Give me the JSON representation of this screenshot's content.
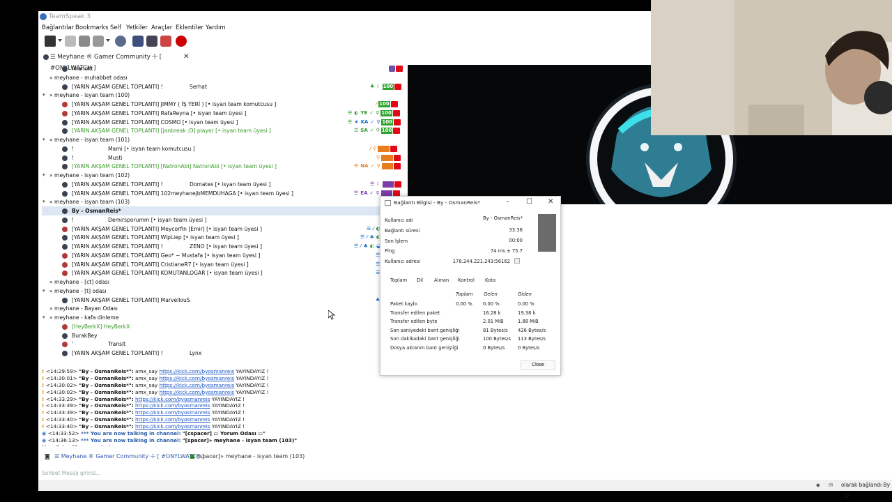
{
  "window": {
    "title": "TeamSpeak 3"
  },
  "menu": [
    "Bağlantılar",
    "Bookmarks",
    "Self",
    "Yetkiler",
    "Araçlar",
    "Eklentiler",
    "Yardım"
  ],
  "server_tab": {
    "label": "☰ Meyhane ® Gamer Community ☩ [ #ONYLWATCH ]"
  },
  "tree": [
    {
      "level": 3,
      "kind": "user",
      "text": "ilhanokt",
      "badges": [
        "sq-purple",
        "tr"
      ]
    },
    {
      "level": 1,
      "kind": "channel",
      "text": "» meyhane - muhabbet odası"
    },
    {
      "level": 3,
      "kind": "user",
      "text": "[YARIN AKŞAM GENEL TOPLANTI] !",
      "text2": "Serhat",
      "badges": [
        "g:♣",
        "g:☾",
        "num:100",
        "tr"
      ]
    },
    {
      "level": 1,
      "kind": "channel-open",
      "text": "» meyhane - isyan team (100)"
    },
    {
      "level": 3,
      "kind": "user-red",
      "text": "[YARIN AKŞAM GENEL TOPLANTI] JIMMY ( İŞ YERİ ) [• isyan team komutcusu ]",
      "badges": [
        "o:⁄",
        "num:100",
        "tr"
      ]
    },
    {
      "level": 3,
      "kind": "user-red",
      "text": "[YARIN AKŞAM GENEL TOPLANTI] RafaReyna [• isyan team üyesi ]",
      "badges": [
        "g:☰",
        "g:◐",
        "g:YE",
        "g:✓",
        "g:⚲",
        "num:100",
        "tr"
      ]
    },
    {
      "level": 3,
      "kind": "user",
      "text": "[YARIN AKŞAM GENEL TOPLANTI] COSMO [• isyan team üyesi ]",
      "badges": [
        "g:☰",
        "b:★",
        "b:KA",
        "b:✓",
        "b:⚲",
        "num:100",
        "tr"
      ]
    },
    {
      "level": 3,
      "kind": "user-green",
      "text": "[YARIN AKŞAM GENEL TOPLANTI] [janbreak :D] player [• isyan team üyesi ]",
      "badges": [
        "g:☰",
        "g:SA",
        "g:✓",
        "g:⚲",
        "num:100",
        "tr"
      ]
    },
    {
      "level": 1,
      "kind": "channel-open",
      "text": "» meyhane - isyan team (101)"
    },
    {
      "level": 3,
      "kind": "user",
      "text": "!",
      "text2": "Mami [• isyan team komutcusu ]",
      "badges": [
        "o:⁄",
        "o:⚲",
        "num-o:101",
        "tr"
      ]
    },
    {
      "level": 3,
      "kind": "user",
      "text": "!",
      "text2": "Musti",
      "badges": [
        "o:⚲",
        "num-o:101",
        "tr"
      ]
    },
    {
      "level": 3,
      "kind": "user-green",
      "text": "[YARIN AKŞAM GENEL TOPLANTI] [NatronAbi] NatronAbi [• isyan team üyesi ]",
      "badges": [
        "o:☰",
        "o:NA",
        "o:✓",
        "o:⚲",
        "num-o:101",
        "tr"
      ]
    },
    {
      "level": 1,
      "kind": "channel-open",
      "text": "» meyhane - isyan team (102)"
    },
    {
      "level": 3,
      "kind": "user",
      "text": "[YARIN AKŞAM GENEL TOPLANTI] !",
      "text2": "Domates [• isyan team üyesi ]",
      "badges": [
        "p:☰",
        "p:☾",
        "num-p:102",
        "tr"
      ]
    },
    {
      "level": 3,
      "kind": "user",
      "text": "[YARIN AKŞAM GENEL TOPLANTI] 102meyhanejbMEMDUHAGA [• isyan team üyesi ]",
      "badges": [
        "p:☰",
        "p:EA",
        "p:✓",
        "p:⚲",
        "num-p:102",
        "tr"
      ]
    },
    {
      "level": 1,
      "kind": "channel-open",
      "text": "» meyhane - isyan team (103)"
    },
    {
      "level": 3,
      "kind": "user-selected",
      "text": "By - OsmanReis*",
      "badges": [
        "b:♣",
        "tr"
      ]
    },
    {
      "level": 3,
      "kind": "user",
      "text": "!",
      "text2": "Demirsporumm [• isyan team üyesi ]",
      "badges": [
        "b:☰",
        "b:⚲"
      ]
    },
    {
      "level": 3,
      "kind": "user-red",
      "text": "[YARIN AKŞAM GENEL TOPLANTI] Meycorfin [Emir] [• isyan team üyesi ]",
      "badges": [
        "b:☰",
        "b:⁄",
        "g:◐",
        "b:☾",
        "b:✓",
        "b:⚲"
      ]
    },
    {
      "level": 3,
      "kind": "user",
      "text": "[YARIN AKŞAM GENEL TOPLANTI] WipLiep [• isyan team üyesi ]",
      "badges": [
        "b:☰",
        "b:⁄",
        "b:♣",
        "g:◐",
        "b:◒",
        "b:✓",
        "b:⚲"
      ]
    },
    {
      "level": 3,
      "kind": "user",
      "text": "[YARIN AKŞAM GENEL TOPLANTI] !",
      "text2": "ZENO [• isyan team üyesi ]",
      "badges": [
        "b:☰",
        "b:⁄",
        "b:♣",
        "g:◐",
        "b:◒",
        "b:C",
        "b:✓",
        "b:⚲"
      ]
    },
    {
      "level": 3,
      "kind": "user-red",
      "text": "[YARIN AKŞAM GENEL TOPLANTI] Geo* ~ Mustafa [• isyan team üyesi ]",
      "badges": [
        "b:☰",
        "b:NA",
        "b:✓",
        "b:⚲"
      ]
    },
    {
      "level": 3,
      "kind": "user-red",
      "text": "[YARIN AKŞAM GENEL TOPLANTI] CristianeR7 [• isyan team üyesi ]",
      "badges": [
        "b:☰",
        "b:SC",
        "b:✓",
        "b:⚲"
      ]
    },
    {
      "level": 3,
      "kind": "user-red",
      "text": "[YARIN AKŞAM GENEL TOPLANTI] KOMUTANLOGAR [• isyan team üyesi ]",
      "badges": [
        "b:☰",
        "b:SC",
        "b:✓",
        "b:⚲"
      ]
    },
    {
      "level": 1,
      "kind": "channel",
      "text": "» meyhane - [ct] odası"
    },
    {
      "level": 1,
      "kind": "channel-open",
      "text": "» meyhane - [t] odası"
    },
    {
      "level": 3,
      "kind": "user",
      "text": "[YARIN AKŞAM GENEL TOPLANTI] MarvellouS",
      "badges": [
        "b:♣",
        "b:KS",
        "b:✓",
        "b:⚲"
      ]
    },
    {
      "level": 1,
      "kind": "channel",
      "text": "» meyhane - Bayan Odası"
    },
    {
      "level": 1,
      "kind": "channel-open",
      "text": "» meyhane - kafa dinleme"
    },
    {
      "level": 3,
      "kind": "user-red-green",
      "text": "[HeyBerkX] HeyBerkX"
    },
    {
      "level": 3,
      "kind": "user",
      "text": "BurakBey"
    },
    {
      "level": 3,
      "kind": "user-red",
      "text": "'",
      "text2": "Transit",
      "badges": [
        "x:♣",
        "x:⚲"
      ]
    },
    {
      "level": 3,
      "kind": "user",
      "text": "[YARIN AKŞAM GENEL TOPLANTI] !",
      "text2": "Lynx",
      "badges": [
        "x:♣",
        "x:⚲"
      ]
    }
  ],
  "chat": [
    {
      "time": "<14:29:59>",
      "user": "\"By - OsmanReis*\":",
      "msg": "amx_say",
      "link": "https://kick.com/byosmanreis",
      "tail": "YAYINDAYIZ !"
    },
    {
      "time": "<14:30:01>",
      "user": "\"By - OsmanReis*\":",
      "msg": "amx_say",
      "link": "https://kick.com/byosmanreis",
      "tail": "YAYINDAYIZ !"
    },
    {
      "time": "<14:30:02>",
      "user": "\"By - OsmanReis*\":",
      "msg": "amx_say",
      "link": "https://kick.com/byosmanreis",
      "tail": "YAYINDAYIZ !"
    },
    {
      "time": "<14:30:02>",
      "user": "\"By - OsmanReis*\":",
      "msg": "amx_say",
      "link": "https://kick.com/byosmanreis",
      "tail": "YAYINDAYIZ !"
    },
    {
      "time": "<14:33:29>",
      "user": "\"By - OsmanReis*\":",
      "msg": "",
      "link": "https://kick.com/byosmanreis",
      "tail": "YAYINDAYIZ !"
    },
    {
      "time": "<14:33:39>",
      "user": "\"By - OsmanReis*\":",
      "msg": "",
      "link": "https://kick.com/byosmanreis",
      "tail": "YAYINDAYIZ !"
    },
    {
      "time": "<14:33:39>",
      "user": "\"By - OsmanReis*\":",
      "msg": "",
      "link": "https://kick.com/byosmanreis",
      "tail": "YAYINDAYIZ !"
    },
    {
      "time": "<14:33:40>",
      "user": "\"By - OsmanReis*\":",
      "msg": "",
      "link": "https://kick.com/byosmanreis",
      "tail": "YAYINDAYIZ !"
    },
    {
      "time": "<14:33:40>",
      "user": "\"By - OsmanReis*\":",
      "msg": "",
      "link": "https://kick.com/byosmanreis",
      "tail": "YAYINDAYIZ !"
    }
  ],
  "chat_info": [
    {
      "time": "<14:33:52>",
      "text": "*** You are now talking in channel:",
      "channel": "\"[cspacer] ▭ Yorum Odası ▭\""
    },
    {
      "time": "<14:36:13>",
      "text": "*** You are now talking in channel:",
      "channel": "\"[spacer]» meyhane - isyan team (103)\""
    }
  ],
  "chat_poke": "Mass Poke: 65 users poked.",
  "chat_tabs": {
    "server": "☰ Meyhane ® Gamer Community ☩ [ #ONYLWATCH ]",
    "channel": "[spacer]» meyhane - isyan team (103)"
  },
  "chat_input": {
    "placeholder": "Sohbet Mesajı giriniz..."
  },
  "statusbar": {
    "text": "olarak bağlandı By - O"
  },
  "conn_dialog": {
    "title": "Bağlantı Bilgisi - By - OsmanReis*",
    "fields": [
      {
        "label": "Kullanıcı adı",
        "value": "By - OsmanReis*"
      },
      {
        "label": "Bağlantı süresi",
        "value": "33:38"
      },
      {
        "label": "Son İşlem",
        "value": "00:00"
      },
      {
        "label": "Ping",
        "value": "74 ms ± 75.7"
      },
      {
        "label": "Kullanıcı adresi",
        "value": "178.244.221.243:56162"
      }
    ],
    "tabs": [
      "Toplam",
      "Dil",
      "Alınan",
      "Kontrol",
      "Kota"
    ],
    "col_heads": [
      "Toplam",
      "Gelen",
      "Giden"
    ],
    "stats": [
      {
        "label": "Paket kaybı",
        "total": "0.00 %",
        "in": "0.00 %",
        "out": "0.00 %"
      },
      {
        "label": "Transfer edilen paket",
        "total": "",
        "in": "16.28 k",
        "out": "19.38 k"
      },
      {
        "label": "Transfer edilen byte",
        "total": "",
        "in": "2.01 MiB",
        "out": "1.88 MiB"
      },
      {
        "label": "Son saniyedeki bant genişliği",
        "total": "",
        "in": "81 Bytes/s",
        "out": "426 Bytes/s"
      },
      {
        "label": "Son dakikadaki bant genişliği",
        "total": "",
        "in": "100 Bytes/s",
        "out": "113 Bytes/s"
      },
      {
        "label": "Dosya aktarım bant genişliği",
        "total": "",
        "in": "0 Bytes/s",
        "out": "0 Bytes/s"
      }
    ],
    "close_label": "Close"
  }
}
